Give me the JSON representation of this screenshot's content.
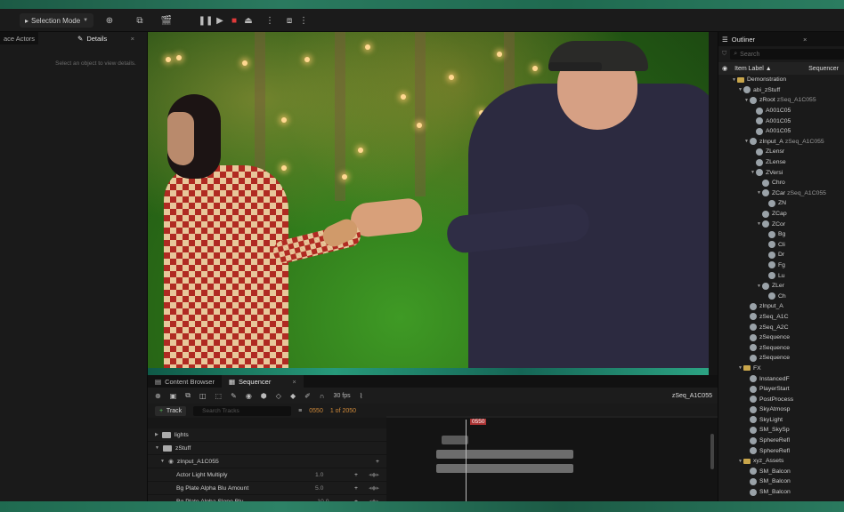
{
  "toolbar": {
    "selection_mode": "Selection Mode"
  },
  "left_panel": {
    "tab_actors": "ace Actors",
    "tab_details": "Details",
    "close": "×",
    "hint": "Select an object to view details."
  },
  "outliner": {
    "tab_label": "Outliner",
    "close": "×",
    "search_placeholder": "Search",
    "col_item_label": "Item Label ▲",
    "col_sequencer": "Sequencer",
    "rows": [
      {
        "indent": 0,
        "arrow": "▼",
        "icon": "folder",
        "label": "Demonstration",
        "seq": ""
      },
      {
        "indent": 1,
        "arrow": "▼",
        "icon": "actor",
        "label": "abi_zStuff",
        "seq": ""
      },
      {
        "indent": 2,
        "arrow": "▼",
        "icon": "actor",
        "label": "zRoot",
        "seq": "zSeq_A1C055"
      },
      {
        "indent": 3,
        "arrow": "",
        "icon": "actor",
        "label": "A001C05",
        "seq": ""
      },
      {
        "indent": 3,
        "arrow": "",
        "icon": "actor",
        "label": "A001C05",
        "seq": ""
      },
      {
        "indent": 3,
        "arrow": "",
        "icon": "actor",
        "label": "A001C05",
        "seq": ""
      },
      {
        "indent": 2,
        "arrow": "▼",
        "icon": "actor",
        "label": "zInput_A",
        "seq": "zSeq_A1C055"
      },
      {
        "indent": 3,
        "arrow": "",
        "icon": "actor",
        "label": "ZLensr",
        "seq": ""
      },
      {
        "indent": 3,
        "arrow": "",
        "icon": "actor",
        "label": "ZLense",
        "seq": ""
      },
      {
        "indent": 3,
        "arrow": "▼",
        "icon": "actor",
        "label": "ZVersi",
        "seq": ""
      },
      {
        "indent": 4,
        "arrow": "",
        "icon": "actor",
        "label": "Chro",
        "seq": ""
      },
      {
        "indent": 4,
        "arrow": "▼",
        "icon": "actor",
        "label": "ZCar",
        "seq": "zSeq_A1C055"
      },
      {
        "indent": 5,
        "arrow": "",
        "icon": "actor",
        "label": "ZN",
        "seq": ""
      },
      {
        "indent": 4,
        "arrow": "",
        "icon": "actor",
        "label": "ZCap",
        "seq": ""
      },
      {
        "indent": 4,
        "arrow": "▼",
        "icon": "actor",
        "label": "ZCor",
        "seq": ""
      },
      {
        "indent": 5,
        "arrow": "",
        "icon": "actor",
        "label": "Bg",
        "seq": ""
      },
      {
        "indent": 5,
        "arrow": "",
        "icon": "actor",
        "label": "Cli",
        "seq": ""
      },
      {
        "indent": 5,
        "arrow": "",
        "icon": "actor",
        "label": "Dr",
        "seq": ""
      },
      {
        "indent": 5,
        "arrow": "",
        "icon": "actor",
        "label": "Fg",
        "seq": ""
      },
      {
        "indent": 5,
        "arrow": "",
        "icon": "actor",
        "label": "Lu",
        "seq": ""
      },
      {
        "indent": 4,
        "arrow": "▼",
        "icon": "actor",
        "label": "ZLer",
        "seq": ""
      },
      {
        "indent": 5,
        "arrow": "",
        "icon": "actor",
        "label": "Ch",
        "seq": ""
      },
      {
        "indent": 2,
        "arrow": "",
        "icon": "actor",
        "label": "zInput_A",
        "seq": ""
      },
      {
        "indent": 2,
        "arrow": "",
        "icon": "actor",
        "label": "zSeq_A1C",
        "seq": ""
      },
      {
        "indent": 2,
        "arrow": "",
        "icon": "actor",
        "label": "zSeq_A2C",
        "seq": ""
      },
      {
        "indent": 2,
        "arrow": "",
        "icon": "actor",
        "label": "zSequence",
        "seq": ""
      },
      {
        "indent": 2,
        "arrow": "",
        "icon": "actor",
        "label": "zSequence",
        "seq": ""
      },
      {
        "indent": 2,
        "arrow": "",
        "icon": "actor",
        "label": "zSequence",
        "seq": ""
      },
      {
        "indent": 1,
        "arrow": "▼",
        "icon": "folder",
        "label": "FX",
        "seq": ""
      },
      {
        "indent": 2,
        "arrow": "",
        "icon": "actor",
        "label": "InstancedF",
        "seq": ""
      },
      {
        "indent": 2,
        "arrow": "",
        "icon": "actor",
        "label": "PlayerStart",
        "seq": ""
      },
      {
        "indent": 2,
        "arrow": "",
        "icon": "actor",
        "label": "PostProcess",
        "seq": ""
      },
      {
        "indent": 2,
        "arrow": "",
        "icon": "actor",
        "label": "SkyAtmosp",
        "seq": ""
      },
      {
        "indent": 2,
        "arrow": "",
        "icon": "actor",
        "label": "SkyLight",
        "seq": ""
      },
      {
        "indent": 2,
        "arrow": "",
        "icon": "actor",
        "label": "SM_SkySp",
        "seq": ""
      },
      {
        "indent": 2,
        "arrow": "",
        "icon": "actor",
        "label": "SphereRefl",
        "seq": ""
      },
      {
        "indent": 2,
        "arrow": "",
        "icon": "actor",
        "label": "SphereRefl",
        "seq": ""
      },
      {
        "indent": 1,
        "arrow": "▼",
        "icon": "folder",
        "label": "xyz_Assets",
        "seq": ""
      },
      {
        "indent": 2,
        "arrow": "",
        "icon": "actor",
        "label": "SM_Balcon",
        "seq": ""
      },
      {
        "indent": 2,
        "arrow": "",
        "icon": "actor",
        "label": "SM_Balcon",
        "seq": ""
      },
      {
        "indent": 2,
        "arrow": "",
        "icon": "actor",
        "label": "SM_Balcon",
        "seq": ""
      }
    ]
  },
  "bottom": {
    "tab_content_browser": "Content Browser",
    "tab_sequencer": "Sequencer",
    "close": "×",
    "fps": "30 fps",
    "sequence_name": "zSeq_A1C055",
    "add_track": "Track",
    "search_tracks_placeholder": "Search Tracks",
    "current_frame": "0550",
    "frame_of": "1 of 2050",
    "playhead_label": "0550",
    "ruler_ticks": [
      "0300",
      "0450",
      "0600",
      "0750",
      "0900"
    ],
    "tracks": [
      {
        "type": "folder",
        "label": "lights",
        "value": ""
      },
      {
        "type": "folder",
        "label": "zStuff",
        "value": ""
      },
      {
        "type": "actor",
        "label": "zInput_A1C055",
        "value": ""
      },
      {
        "type": "prop",
        "label": "Actor Light Multiply",
        "value": "1.0"
      },
      {
        "type": "prop",
        "label": "Bg Plate Alpha Blu Amount",
        "value": "5.0"
      },
      {
        "type": "prop",
        "label": "Bg Plate Alpha Slope Blu",
        "value": "-10.0"
      }
    ]
  }
}
